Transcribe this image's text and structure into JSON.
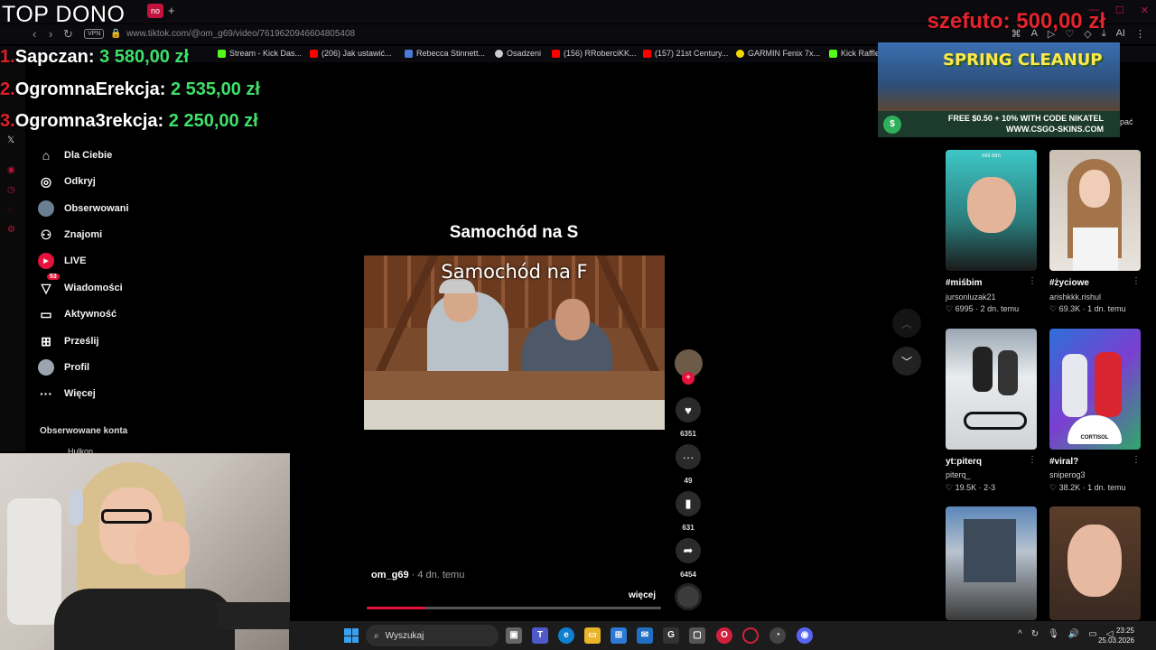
{
  "browser": {
    "tab_label": "no",
    "new_tab": "+",
    "vpn": "VPN",
    "url": "www.tiktok.com/@om_g69/video/7619620946604805408",
    "bookmarks": [
      {
        "label": "Stream - Kick Das...",
        "color": "#53fc18"
      },
      {
        "label": "(206) Jak ustawić...",
        "color": "#ff0000"
      },
      {
        "label": "Rebecca Stinnett...",
        "color": "#4a7bd8"
      },
      {
        "label": "Osadzeni",
        "color": "#cccccc"
      },
      {
        "label": "(156) RRoberciKK...",
        "color": "#ff0000"
      },
      {
        "label": "(157) 21st Century...",
        "color": "#ff0000"
      },
      {
        "label": "GARMIN Fenix 7x...",
        "color": "#f5d800"
      },
      {
        "label": "Kick Raffle",
        "color": "#53fc18"
      }
    ],
    "tool_ai": "AI"
  },
  "overlay": {
    "top_dono": "TOP DONO",
    "donations": [
      {
        "rank": "1.",
        "name": "Sapczan:",
        "amount": "3 580,00 zł"
      },
      {
        "rank": "2.",
        "name": "OgromnaErekcja:",
        "amount": "2 535,00 zł"
      },
      {
        "rank": "3.",
        "name": "Ogromna3rekcja:",
        "amount": "2 250,00 zł"
      }
    ],
    "latest_name": "szefuto:",
    "latest_amount": "500,00 zł"
  },
  "nav": {
    "items": [
      {
        "label": "Dla Ciebie",
        "icon": "home-icon"
      },
      {
        "label": "Odkryj",
        "icon": "compass-icon"
      },
      {
        "label": "Obserwowani",
        "icon": "avatar-icon"
      },
      {
        "label": "Znajomi",
        "icon": "friends-icon"
      },
      {
        "label": "LIVE",
        "icon": "live-icon"
      },
      {
        "label": "Wiadomości",
        "icon": "messages-icon",
        "badge": "53"
      },
      {
        "label": "Aktywność",
        "icon": "activity-icon"
      },
      {
        "label": "Prześlij",
        "icon": "upload-icon"
      },
      {
        "label": "Profil",
        "icon": "profile-icon"
      },
      {
        "label": "Więcej",
        "icon": "more-icon"
      }
    ],
    "followed_title": "Obserwowane konta",
    "followed_first": "Hulkon"
  },
  "video": {
    "title": "Samochód na S",
    "overlay_text": "Samochód na F",
    "author": "om_g69",
    "time": " · 4 dn. temu",
    "more": "więcej",
    "progress": 0.2,
    "likes": "6351",
    "comments": "49",
    "saves": "631",
    "shares": "6454"
  },
  "ad": {
    "title": "SPRING CLEANUP",
    "line1": "FREE $0.50 + 10% WITH CODE NIKATEL",
    "line2": "WWW.CSGO-SKINS.COM",
    "partial": "pać"
  },
  "recommendations": [
    {
      "title": "#miśbim",
      "author": "jursonluzak21",
      "likes": "6995",
      "age": "2 dn. temu",
      "caption": "miś bim"
    },
    {
      "title": "#życiowe",
      "author": "arishkkk.rishul",
      "likes": "69.3K",
      "age": "1 dn. temu",
      "caption": ""
    },
    {
      "title": "yt:piterq",
      "author": "piterq_",
      "likes": "19.5K",
      "age": "2-3",
      "caption": ""
    },
    {
      "title": "#viral?",
      "author": "sniperog3",
      "likes": "38.2K",
      "age": "1 dn. temu",
      "caption": "CORTISOL"
    },
    {
      "title": "",
      "author": "",
      "likes": "",
      "age": "",
      "caption": ""
    },
    {
      "title": "",
      "author": "",
      "likes": "",
      "age": "",
      "caption": ""
    }
  ],
  "taskbar": {
    "search": "Wyszukaj",
    "time": "23:25",
    "date": "25.03.2026"
  }
}
